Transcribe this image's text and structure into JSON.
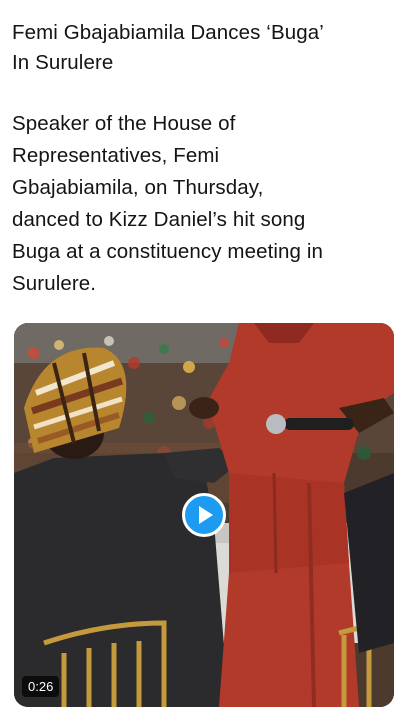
{
  "post": {
    "headline": "Femi Gbajabiamila Dances ‘Buga’\nIn Surulere",
    "body": "Speaker of the House of\nRepresentatives, Femi\nGbajabiamila, on Thursday,\ndanced to Kizz Daniel’s hit song\nBuga at a constituency meeting in\nSurulere."
  },
  "video": {
    "duration": "0:26",
    "play_icon": "play-icon",
    "accent_color": "#1d9bf0"
  }
}
